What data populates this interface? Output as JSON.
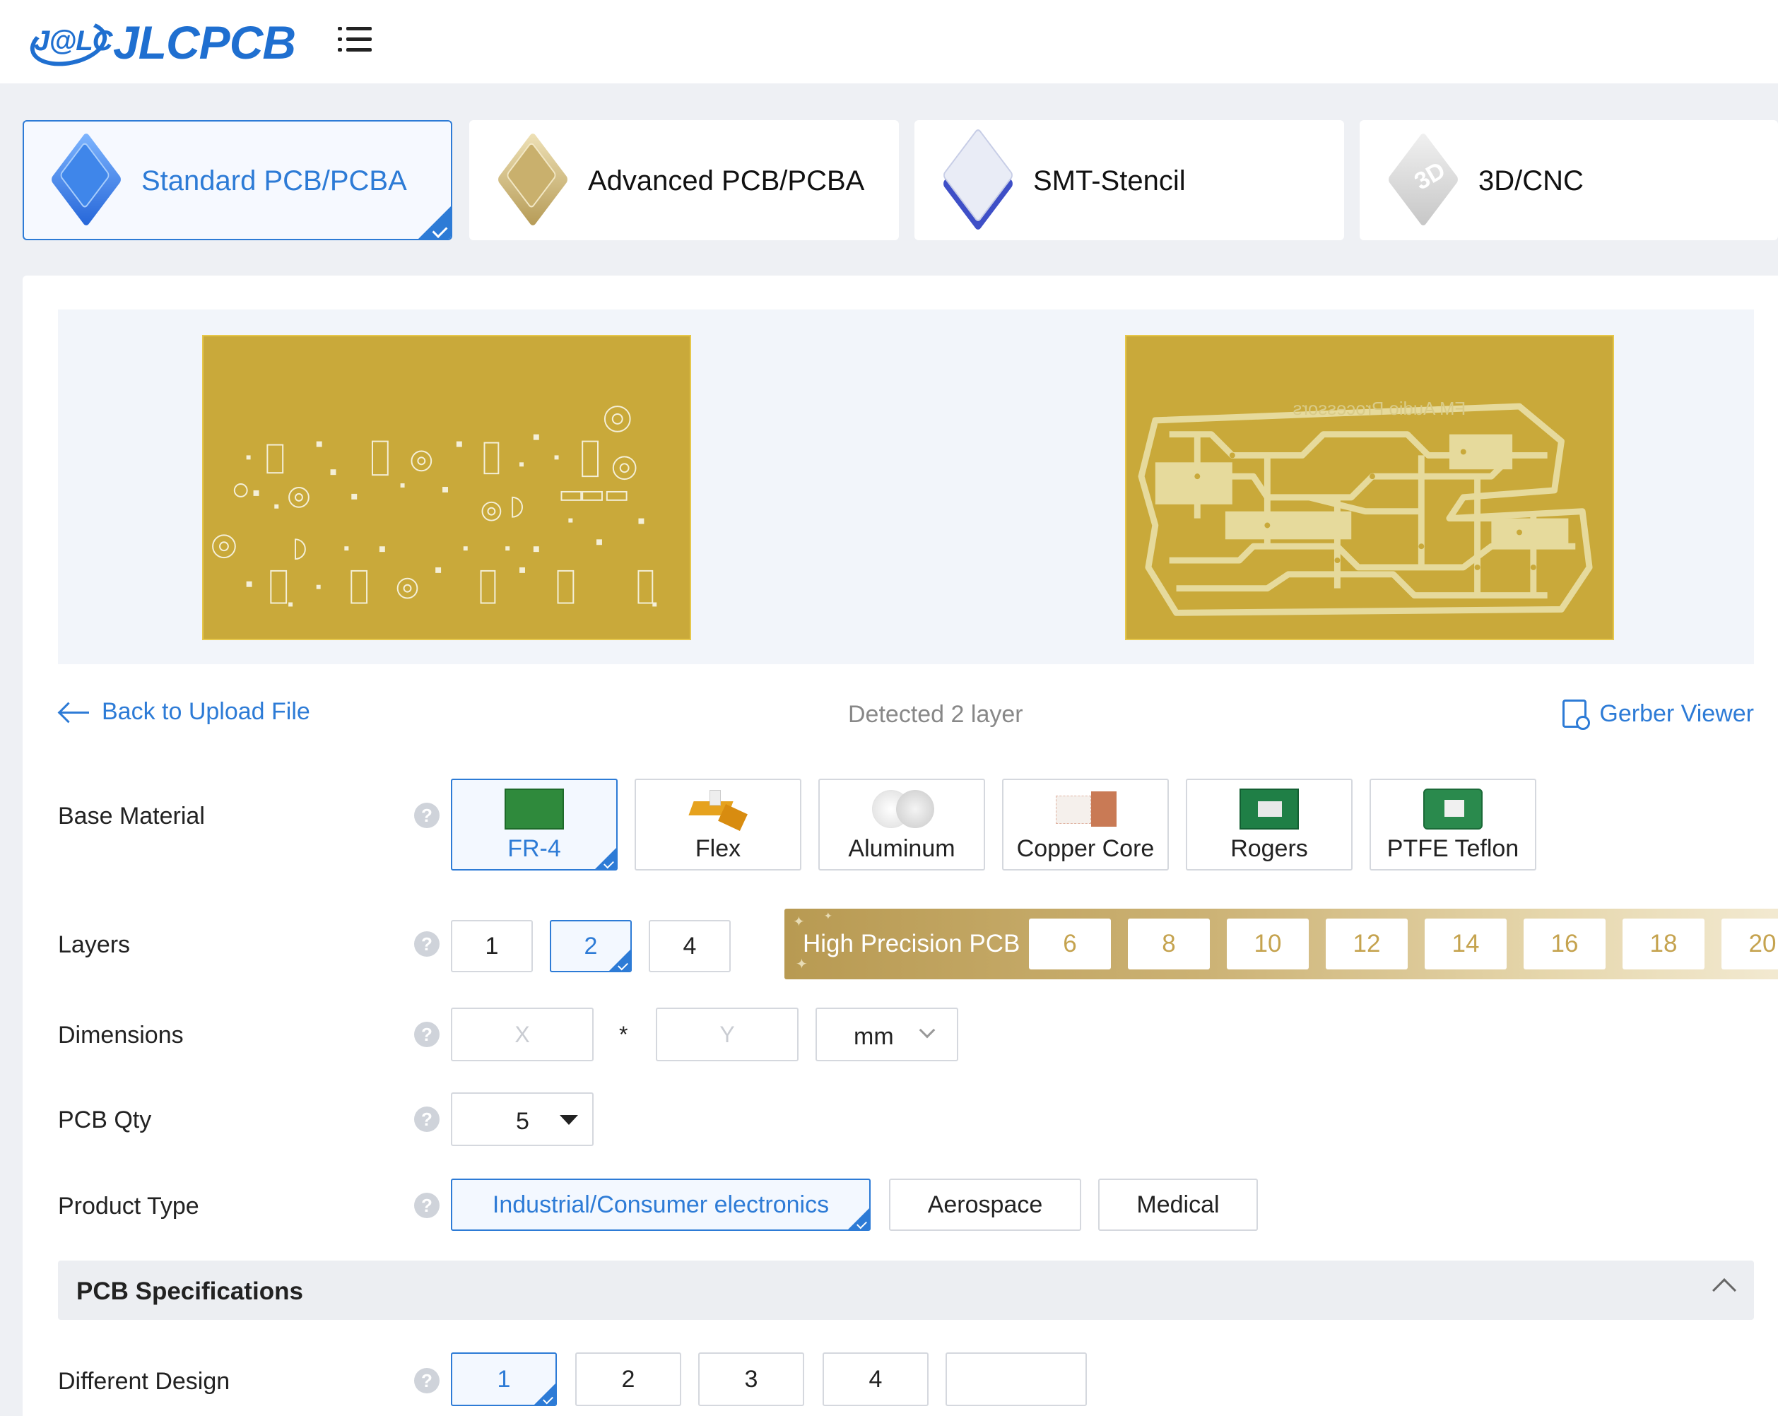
{
  "header": {
    "logo_badge": "J@LC",
    "logo_text": "JLCPCB",
    "menu_icon": "menu-list-icon"
  },
  "product_tabs": [
    {
      "label": "Standard PCB/PCBA",
      "selected": true,
      "icon": "standard-pcb-icon"
    },
    {
      "label": "Advanced PCB/PCBA",
      "selected": false,
      "icon": "advanced-pcb-icon"
    },
    {
      "label": "SMT-Stencil",
      "selected": false,
      "icon": "smt-stencil-icon"
    },
    {
      "label": "3D/CNC",
      "selected": false,
      "icon": "3d-cnc-icon"
    }
  ],
  "preview": {
    "board_text": "FM Audio Processors"
  },
  "links": {
    "back": "Back to Upload File",
    "detected": "Detected 2 layer",
    "gerber": "Gerber Viewer"
  },
  "form": {
    "base_material": {
      "label": "Base Material",
      "options": [
        "FR-4",
        "Flex",
        "Aluminum",
        "Copper Core",
        "Rogers",
        "PTFE Teflon"
      ],
      "selected": "FR-4"
    },
    "layers": {
      "label": "Layers",
      "options": [
        "1",
        "2",
        "4"
      ],
      "selected": "2",
      "high_precision_label": "High Precision PCB",
      "high_precision_options": [
        "6",
        "8",
        "10",
        "12",
        "14",
        "16",
        "18",
        "20"
      ]
    },
    "dimensions": {
      "label": "Dimensions",
      "x_placeholder": "X",
      "separator": "*",
      "y_placeholder": "Y",
      "unit": "mm"
    },
    "pcb_qty": {
      "label": "PCB Qty",
      "value": "5"
    },
    "product_type": {
      "label": "Product Type",
      "options": [
        "Industrial/Consumer electronics",
        "Aerospace",
        "Medical"
      ],
      "selected": "Industrial/Consumer electronics"
    }
  },
  "specifications": {
    "title": "PCB Specifications",
    "different_design": {
      "label": "Different Design",
      "options": [
        "1",
        "2",
        "3",
        "4"
      ],
      "selected": "1",
      "custom_value": ""
    }
  },
  "colors": {
    "accent": "#2d7bd6",
    "board_gold": "#c9a93a",
    "trace_light": "#e6da9c",
    "hp_gold": "#c5a34f"
  }
}
